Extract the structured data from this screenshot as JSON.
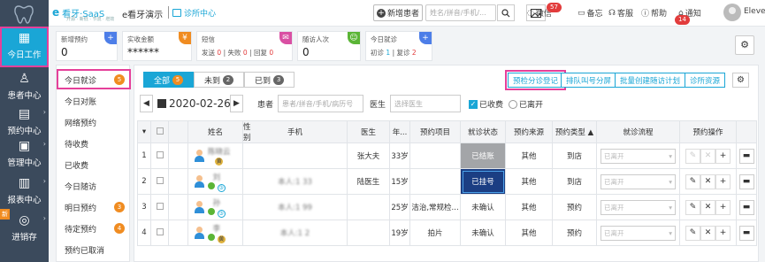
{
  "rail": {
    "items": [
      {
        "label": "今日工作",
        "icon": "grid-icon"
      },
      {
        "label": "患者中心",
        "icon": "user-icon"
      },
      {
        "label": "预约中心",
        "icon": "calendar-icon"
      },
      {
        "label": "管理中心",
        "icon": "briefcase-icon"
      },
      {
        "label": "报表中心",
        "icon": "bar-chart-icon"
      },
      {
        "label": "进销存",
        "icon": "globe-icon"
      }
    ],
    "new_badge": "新"
  },
  "topbar": {
    "brand_e": "e",
    "brand_name": "看牙·SaaS",
    "slogan": "开源 · 新低 · 节流 · 增效",
    "clinic": "e看牙演示",
    "clinic_center": "诊所中心",
    "new_patient": "新增患者",
    "search_placeholder": "姓名/拼音/手机/...",
    "wechat": "微信",
    "wechat_count": "57",
    "memo": "备忘",
    "service": "客服",
    "help": "帮助",
    "notice": "通知",
    "notice_count": "14",
    "user": "Eleven"
  },
  "stats": [
    {
      "label": "新增预约",
      "value": "0",
      "corner": "+",
      "color": "#4d7ee8"
    },
    {
      "label": "实收金额",
      "value": "******",
      "corner": "¥",
      "color": "#f08c21"
    },
    {
      "label": "短信",
      "sub": [
        "发送",
        "0",
        "失败",
        "0",
        "回复",
        "0"
      ],
      "corner": "✉",
      "color": "#d94fa3"
    },
    {
      "label": "随访人次",
      "value": "0",
      "corner": "☺",
      "color": "#5bb536"
    },
    {
      "label": "今日就诊",
      "sub": [
        "初诊",
        "1",
        "复诊",
        "2"
      ],
      "corner": "+",
      "color": "#4d7ee8"
    }
  ],
  "subnav": [
    {
      "label": "今日就诊",
      "count": "5"
    },
    {
      "label": "今日对账"
    },
    {
      "label": "网络预约"
    },
    {
      "label": "待收费"
    },
    {
      "label": "已收费"
    },
    {
      "label": "今日随访"
    },
    {
      "label": "明日预约",
      "count": "3"
    },
    {
      "label": "待定预约",
      "count": "4"
    },
    {
      "label": "预约已取消"
    }
  ],
  "tabs": [
    {
      "label": "全部",
      "count": "5"
    },
    {
      "label": "未到",
      "count": "2"
    },
    {
      "label": "已到",
      "count": "3"
    }
  ],
  "actions": [
    "预检分诊登记",
    "排队叫号分屏",
    "批量创建随访计划",
    "诊所资源"
  ],
  "filter": {
    "prev": "◀",
    "next": "▶",
    "date": "2020-02-26",
    "patient_label": "患者",
    "patient_placeholder": "患者/拼音/手机/病历号",
    "doctor_label": "医生",
    "doctor_placeholder": "选择医生",
    "charged": "已收费",
    "left": "已离开"
  },
  "table": {
    "headers": [
      "",
      "",
      "",
      "姓名",
      "性别",
      "手机",
      "医生",
      "年...",
      "预约项目",
      "就诊状态",
      "预约来源",
      "预约类型 ▲",
      "就诊流程",
      "预约操作",
      "",
      ""
    ],
    "rows": [
      {
        "no": "1",
        "name": "陈晓云",
        "phone": "",
        "doctor": "张大夫",
        "age": "33岁",
        "item": "",
        "status": "已结账",
        "source": "其他",
        "type": "到店",
        "tag": "黄"
      },
      {
        "no": "2",
        "name": "刘",
        "phone": "本人:1        33",
        "doctor": "陆医生",
        "age": "15岁",
        "item": "",
        "status": "已挂号",
        "source": "其他",
        "type": "到店",
        "tag": "③"
      },
      {
        "no": "3",
        "name": "孙",
        "phone": "本人:1        99",
        "doctor": "",
        "age": "25岁",
        "item": "洁治,常规检...",
        "status": "未确认",
        "source": "其他",
        "type": "预约",
        "tag": "③"
      },
      {
        "no": "4",
        "name": "李",
        "phone": "本人:1        2",
        "doctor": "",
        "age": "19岁",
        "item": "拍片",
        "status": "未确认",
        "source": "其他",
        "type": "预约",
        "tag": "黄"
      }
    ],
    "flow_placeholder": "已离开",
    "op_icons": [
      "pencil-icon",
      "close-icon",
      "plus-icon"
    ],
    "chat_icon": "comment-icon"
  }
}
